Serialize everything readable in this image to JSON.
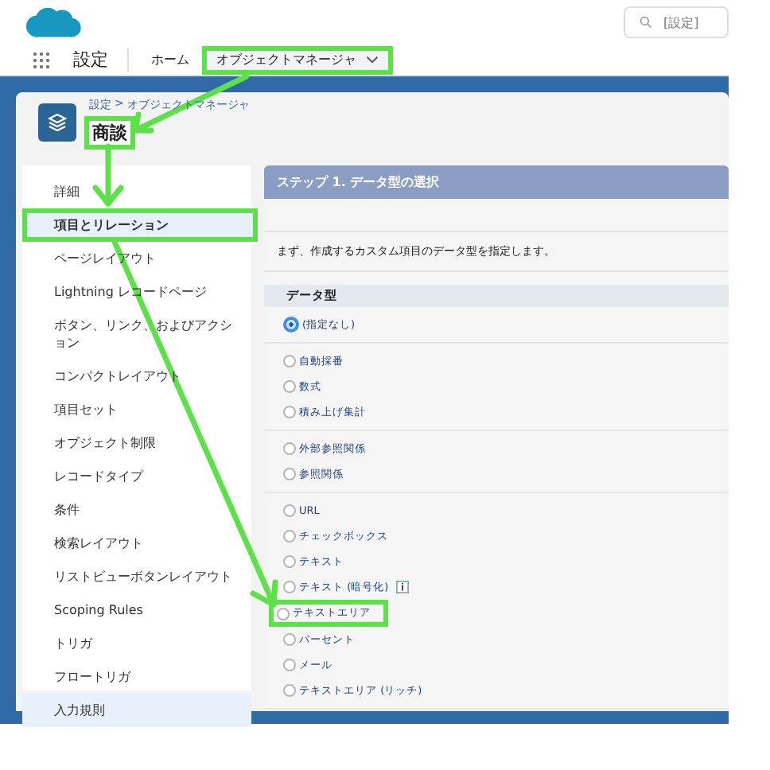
{
  "header": {
    "search": {
      "placeholder": "[設定]"
    }
  },
  "nav": {
    "app_name": "設定",
    "tabs": [
      {
        "label": "ホーム",
        "selected": false,
        "highlighted": false
      },
      {
        "label": "オブジェクトマネージャ",
        "selected": true,
        "highlighted": true
      }
    ]
  },
  "object_header": {
    "breadcrumb": [
      {
        "label": "設定"
      },
      {
        "label": "オブジェクトマネージャ"
      }
    ],
    "separator": ">",
    "title": "商談",
    "title_highlighted": true
  },
  "sidebar": {
    "items": [
      {
        "label": "詳細",
        "selected": false,
        "highlighted": false
      },
      {
        "label": "項目とリレーション",
        "selected": true,
        "highlighted": true
      },
      {
        "label": "ページレイアウト",
        "selected": false,
        "highlighted": false
      },
      {
        "label": "Lightning レコードページ",
        "selected": false,
        "highlighted": false
      },
      {
        "label": "ボタン、リンク、およびアクション",
        "selected": false,
        "highlighted": false
      },
      {
        "label": "コンパクトレイアウト",
        "selected": false,
        "highlighted": false
      },
      {
        "label": "項目セット",
        "selected": false,
        "highlighted": false
      },
      {
        "label": "オブジェクト制限",
        "selected": false,
        "highlighted": false
      },
      {
        "label": "レコードタイプ",
        "selected": false,
        "highlighted": false
      },
      {
        "label": "条件",
        "selected": false,
        "highlighted": false
      },
      {
        "label": "検索レイアウト",
        "selected": false,
        "highlighted": false
      },
      {
        "label": "リストビューボタンレイアウト",
        "selected": false,
        "highlighted": false
      },
      {
        "label": "Scoping Rules",
        "selected": false,
        "highlighted": false
      },
      {
        "label": "トリガ",
        "selected": false,
        "highlighted": false
      },
      {
        "label": "フロートリガ",
        "selected": false,
        "highlighted": false
      },
      {
        "label": "入力規則",
        "selected": true,
        "highlighted": false
      }
    ]
  },
  "step": {
    "title": "ステップ 1. データ型の選択",
    "description": "まず、作成するカスタム項目のデータ型を指定します。",
    "section_title": "データ型",
    "groups": [
      [
        {
          "label": "(指定なし)",
          "selected": true,
          "highlighted": false,
          "info": false
        }
      ],
      [
        {
          "label": "自動採番",
          "selected": false,
          "highlighted": false,
          "info": false
        },
        {
          "label": "数式",
          "selected": false,
          "highlighted": false,
          "info": false
        },
        {
          "label": "積み上げ集計",
          "selected": false,
          "highlighted": false,
          "info": false
        }
      ],
      [
        {
          "label": "外部参照関係",
          "selected": false,
          "highlighted": false,
          "info": false
        },
        {
          "label": "参照関係",
          "selected": false,
          "highlighted": false,
          "info": false
        }
      ],
      [
        {
          "label": "URL",
          "selected": false,
          "highlighted": false,
          "info": false
        },
        {
          "label": "チェックボックス",
          "selected": false,
          "highlighted": false,
          "info": false
        },
        {
          "label": "テキスト",
          "selected": false,
          "highlighted": false,
          "info": false
        },
        {
          "label": "テキスト (暗号化)",
          "selected": false,
          "highlighted": false,
          "info": true
        },
        {
          "label": "テキストエリア",
          "selected": false,
          "highlighted": true,
          "info": false
        },
        {
          "label": "パーセント",
          "selected": false,
          "highlighted": false,
          "info": false
        },
        {
          "label": "メール",
          "selected": false,
          "highlighted": false,
          "info": false
        },
        {
          "label": "テキストエリア (リッチ)",
          "selected": false,
          "highlighted": false,
          "info": false
        }
      ]
    ]
  }
}
